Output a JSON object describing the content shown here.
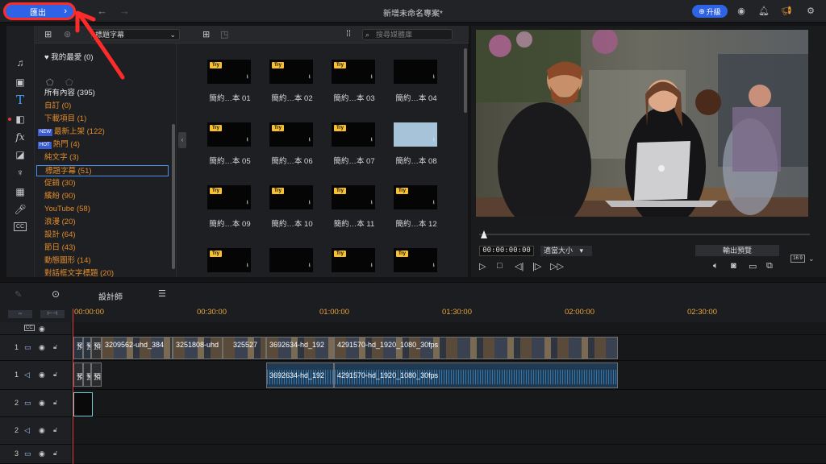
{
  "app": {
    "export_label": "匯出",
    "project_title": "新增未命名專案*",
    "upgrade_label": "升級"
  },
  "library": {
    "category": "標題字幕",
    "search_placeholder": "搜尋媒體庫",
    "categories": [
      {
        "label": "我的最愛 (0)"
      },
      {
        "label": "所有內容 (395)"
      },
      {
        "label": "自訂 (0)"
      },
      {
        "label": "下載項目 (1)"
      },
      {
        "label": "最新上架 (122)",
        "badge": "NEW"
      },
      {
        "label": "熱門 (4)",
        "badge": "HOT"
      },
      {
        "label": "純文字 (3)"
      },
      {
        "label": "標題字幕 (51)"
      },
      {
        "label": "促銷 (30)"
      },
      {
        "label": "繽紛 (90)"
      },
      {
        "label": "YouTube (58)"
      },
      {
        "label": "浪漫 (20)"
      },
      {
        "label": "設計 (64)"
      },
      {
        "label": "節日 (43)"
      },
      {
        "label": "動態圖形 (14)"
      },
      {
        "label": "對話框文字標題 (20)"
      }
    ],
    "try_label": "Try",
    "templates": [
      {
        "name": "簡約…本 01"
      },
      {
        "name": "簡約…本 02"
      },
      {
        "name": "簡約…本 03"
      },
      {
        "name": "簡約…本 04"
      },
      {
        "name": "簡約…本 05"
      },
      {
        "name": "簡約…本 06"
      },
      {
        "name": "簡約…本 07"
      },
      {
        "name": "簡約…本 08"
      },
      {
        "name": "簡約…本 09"
      },
      {
        "name": "簡約…本 10"
      },
      {
        "name": "簡約…本 11"
      },
      {
        "name": "簡約…本 12"
      },
      {
        "name": ""
      },
      {
        "name": ""
      },
      {
        "name": ""
      },
      {
        "name": ""
      }
    ]
  },
  "preview": {
    "timecode": "00:00:00:00",
    "fit_label": "適當大小",
    "output_preview_label": "輸出預覽",
    "ratio": "16:9"
  },
  "timeline": {
    "designer_label": "設計師",
    "ruler": [
      "00:00:00",
      "00:30:00",
      "01:00:00",
      "01:30:00",
      "02:00:00",
      "02:30:00"
    ],
    "tracks": [
      {
        "num": "1"
      },
      {
        "num": "1"
      },
      {
        "num": "2"
      },
      {
        "num": "2"
      },
      {
        "num": "3"
      }
    ],
    "clips": {
      "v1": [
        "預",
        "預",
        "3209562-uhd_384",
        "3251808-uhd",
        "325527",
        "3692634-hd_192",
        "4291570-hd_1920_1080_30fps"
      ],
      "a1": [
        "預",
        "預",
        "3692634-hd_192",
        "4291570-hd_1920_1080_30fps"
      ]
    }
  }
}
